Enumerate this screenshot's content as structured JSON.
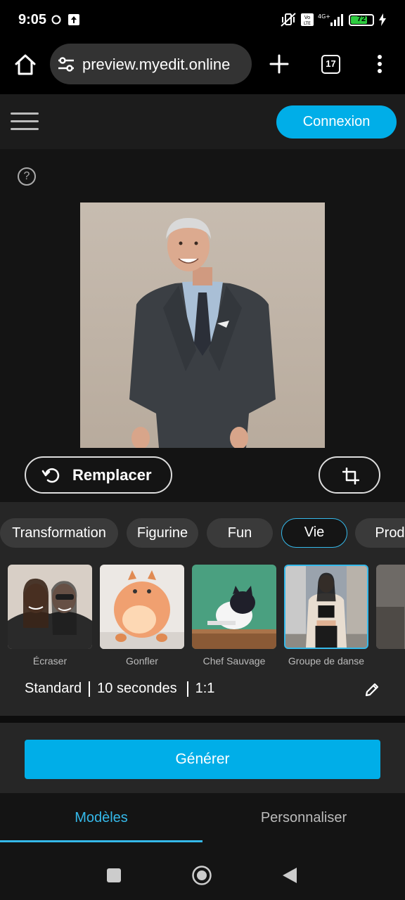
{
  "status_bar": {
    "time": "9:05",
    "battery": "72"
  },
  "browser": {
    "url": "preview.myedit.online",
    "tab_count": "17"
  },
  "header": {
    "login_label": "Connexion"
  },
  "main": {
    "help_symbol": "?",
    "replace_label": "Remplacer"
  },
  "categories": [
    {
      "label": "Transformation",
      "active": false
    },
    {
      "label": "Figurine",
      "active": false
    },
    {
      "label": "Fun",
      "active": false
    },
    {
      "label": "Vie",
      "active": true
    },
    {
      "label": "Produit",
      "active": false
    }
  ],
  "templates": [
    {
      "label": "Écraser",
      "selected": false
    },
    {
      "label": "Gonfler",
      "selected": false
    },
    {
      "label": "Chef Sauvage",
      "selected": false
    },
    {
      "label": "Groupe de danse",
      "selected": true
    }
  ],
  "settings": {
    "quality": "Standard",
    "duration": "10 secondes",
    "ratio": "1:1"
  },
  "generate_label": "Générer",
  "bottom_tabs": {
    "models": "Modèles",
    "customize": "Personnaliser"
  },
  "colors": {
    "accent": "#00aee8",
    "active_border": "#35b9ea"
  }
}
